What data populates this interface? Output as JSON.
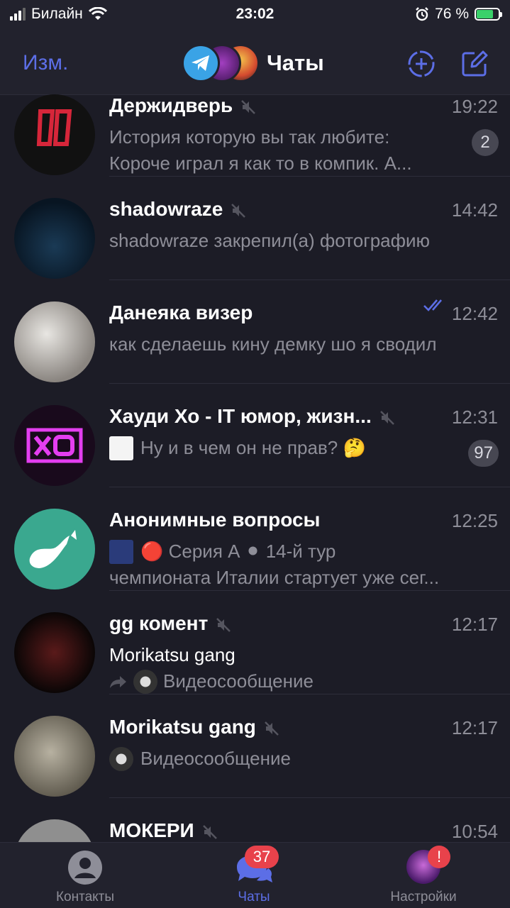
{
  "status_bar": {
    "carrier": "Билайн",
    "time": "23:02",
    "battery": "76 %",
    "battery_level": 0.76
  },
  "header": {
    "edit_label": "Изм.",
    "title": "Чаты"
  },
  "chats": [
    {
      "name": "Держидверь",
      "time": "19:22",
      "muted": true,
      "message_line1": "История которую вы так любите:",
      "message_line2": "Короче играл я как то в компик. А...",
      "unread": "2"
    },
    {
      "name": "shadowraze",
      "time": "14:42",
      "muted": true,
      "message_line1": "shadowraze закрепил(а) фотографию"
    },
    {
      "name": "Данеяка визер",
      "time": "12:42",
      "read_receipt": true,
      "message_line1": "как сделаешь кину демку шо я сводил"
    },
    {
      "name": "Хауди Хо - IT юмор, жизн...",
      "time": "12:31",
      "muted": true,
      "message_line1": "Ну и в чем он не прав? 🤔",
      "unread": "97"
    },
    {
      "name": "Анонимные вопросы",
      "time": "12:25",
      "message_line1": "🔴 Серия А ⚫ 14-й тур",
      "message_line2": "чемпионата Италии стартует уже сег..."
    },
    {
      "name": "gg комент",
      "time": "12:17",
      "muted": true,
      "sender": "Morikatsu gang",
      "message_line1": "Видеосообщение"
    },
    {
      "name": "Morikatsu gang",
      "time": "12:17",
      "muted": true,
      "message_line1": "Видеосообщение"
    },
    {
      "name": "МОКЕРИ",
      "time": "10:54",
      "muted": true
    }
  ],
  "tabbar": {
    "contacts": "Контакты",
    "chats": "Чаты",
    "chats_badge": "37",
    "settings": "Настройки",
    "settings_badge": "!"
  },
  "colors": {
    "accent": "#5c6ee6",
    "background": "#1c1c26",
    "badge_red": "#e8424b"
  }
}
